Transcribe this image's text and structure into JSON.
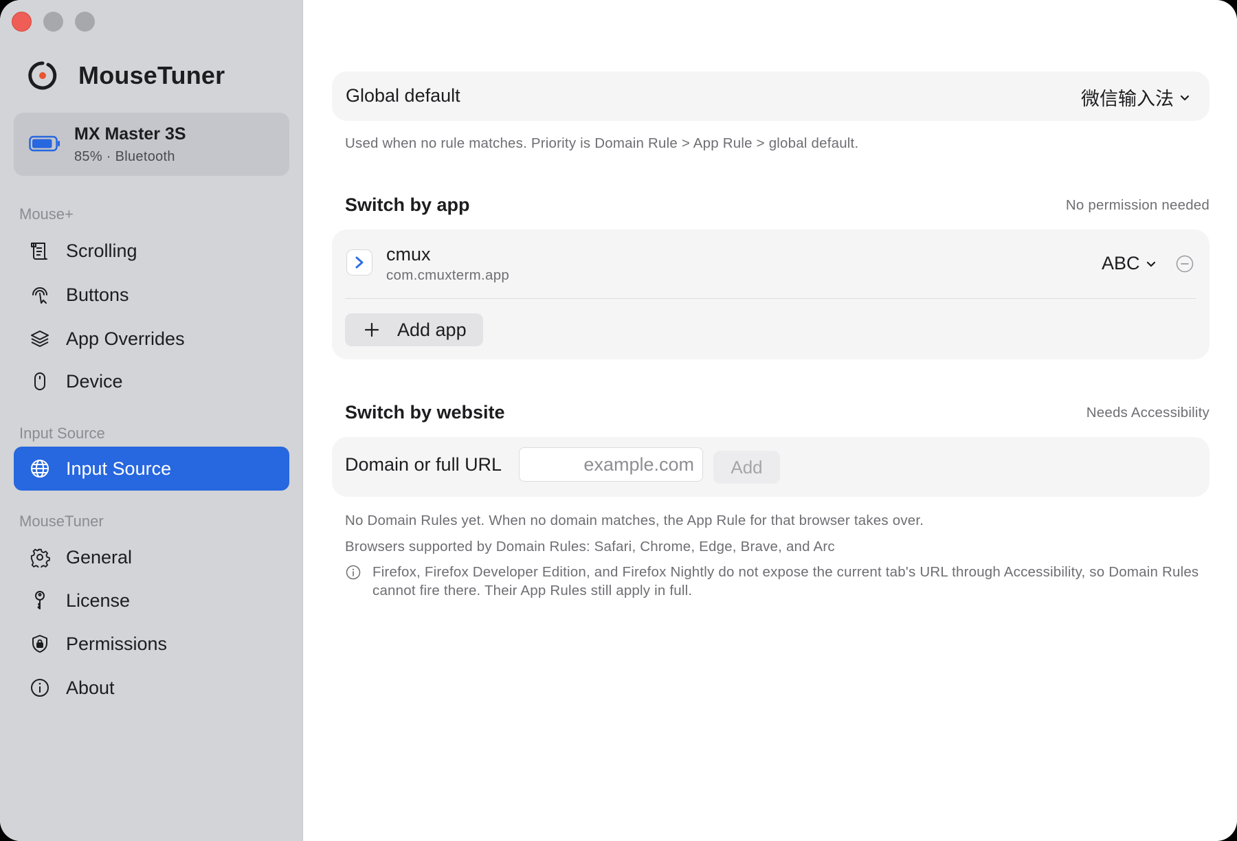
{
  "window": {
    "controls": [
      "close",
      "minimize",
      "maximize"
    ]
  },
  "sidebar": {
    "app_name": "MouseTuner",
    "device": {
      "name": "MX Master 3S",
      "status": "85% · Bluetooth",
      "battery_level": 0.85,
      "battery_color": "#2767df"
    },
    "sections": [
      {
        "label": "Mouse+",
        "items": [
          {
            "label": "Scrolling",
            "icon": "scroll-icon"
          },
          {
            "label": "Buttons",
            "icon": "pointer-tap-icon"
          },
          {
            "label": "App Overrides",
            "icon": "layers-icon"
          },
          {
            "label": "Device",
            "icon": "mouse-icon"
          }
        ]
      },
      {
        "label": "Input Source",
        "items": [
          {
            "label": "Input Source",
            "icon": "globe-icon",
            "active": true
          }
        ]
      },
      {
        "label": "MouseTuner",
        "items": [
          {
            "label": "General",
            "icon": "gear-icon"
          },
          {
            "label": "License",
            "icon": "key-icon"
          },
          {
            "label": "Permissions",
            "icon": "shield-lock-icon"
          },
          {
            "label": "About",
            "icon": "info-icon"
          }
        ]
      }
    ],
    "accent_color": "#2767df"
  },
  "main": {
    "global_default": {
      "title": "Global default",
      "value": "微信输入法",
      "caption": "Used when no rule matches. Priority is Domain Rule > App Rule > global default."
    },
    "switch_by_app": {
      "title": "Switch by app",
      "note": "No permission needed",
      "apps": [
        {
          "name": "cmux",
          "bundle_id": "com.cmuxterm.app",
          "input_source": "ABC",
          "icon": "terminal-chevron-icon"
        }
      ],
      "add_label": "Add app"
    },
    "switch_by_website": {
      "title": "Switch by website",
      "note": "Needs Accessibility",
      "field_label": "Domain or full URL",
      "placeholder": "example.com",
      "value": "",
      "add_label": "Add",
      "empty_text": "No Domain Rules yet. When no domain matches, the App Rule for that browser takes over.",
      "supported_text": "Browsers supported by Domain Rules: Safari, Chrome, Edge, Brave, and Arc",
      "info_text": "Firefox, Firefox Developer Edition, and Firefox Nightly do not expose the current tab's URL through Accessibility, so Domain Rules cannot fire there. Their App Rules still apply in full."
    }
  }
}
